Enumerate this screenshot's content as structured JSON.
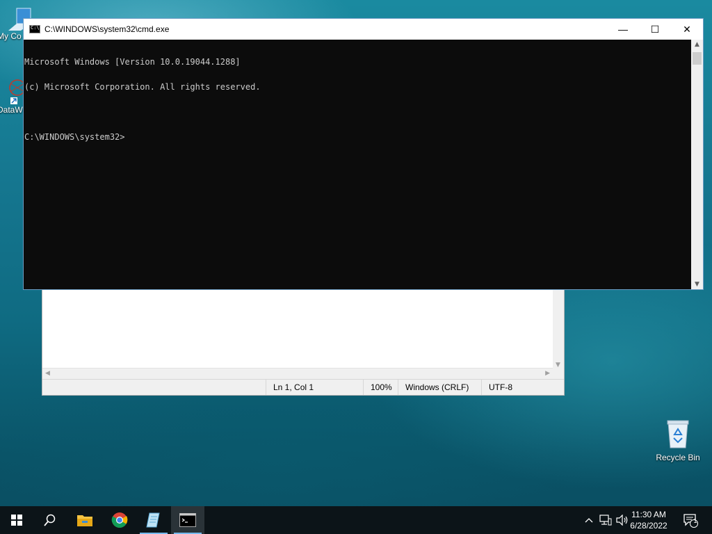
{
  "desktop": {
    "icons": [
      {
        "label": "My Co"
      },
      {
        "label": "DataW"
      },
      {
        "label": "Recycle Bin"
      }
    ]
  },
  "cmd_window": {
    "title": "C:\\WINDOWS\\system32\\cmd.exe",
    "icon_text": "C:\\.",
    "minimize": "—",
    "maximize": "☐",
    "close": "✕",
    "lines": [
      "Microsoft Windows [Version 10.0.19044.1288]",
      "(c) Microsoft Corporation. All rights reserved.",
      "",
      "C:\\WINDOWS\\system32>"
    ]
  },
  "notepad_window": {
    "status": {
      "position": "Ln 1, Col 1",
      "zoom": "100%",
      "line_endings": "Windows (CRLF)",
      "encoding": "UTF-8"
    }
  },
  "taskbar": {
    "apps": [
      "start-icon",
      "search-icon",
      "file-explorer-icon",
      "chrome-icon",
      "notepad-icon",
      "cmd-icon"
    ],
    "clock": {
      "time": "11:30 AM",
      "date": "6/28/2022"
    },
    "notification_count": "1"
  },
  "colors": {
    "console_bg": "#0c0c0c",
    "console_fg": "#cccccc",
    "taskbar_bg": "#0c1418",
    "accent": "#76b9ed"
  }
}
